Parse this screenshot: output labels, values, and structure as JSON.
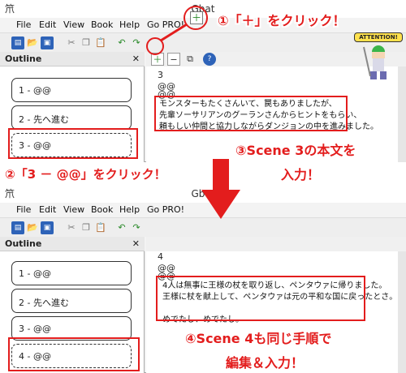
{
  "app": {
    "title": "Gbat",
    "icon_glyph": "笊"
  },
  "menu": [
    "File",
    "Edit",
    "View",
    "Book",
    "Help",
    "Go PRO!"
  ],
  "outline": {
    "header": "Outline",
    "close_glyph": "✕"
  },
  "top_window": {
    "scenes": [
      "1 - @@",
      "2 - 先へ進む",
      "3 - @@"
    ],
    "editor": {
      "scene_no": "3",
      "line1": "@@",
      "line2": "@@",
      "body": [
        "モンスターもたくさんいて、罠もありましたが、",
        "先輩ソーサリアンのグーランさんからヒントをもらい、",
        "頼もしい仲間と協力しながらダンジョンの中を進みました。"
      ]
    }
  },
  "bottom_window": {
    "scenes": [
      "1 - @@",
      "2 - 先へ進む",
      "3 - @@",
      "4 - @@"
    ],
    "editor": {
      "scene_no": "4",
      "line1": "@@",
      "line2": "@@",
      "body": [
        "4人は無事に王様の杖を取り返し、ペンタウァに帰りました。",
        "王様に杖を献上して、ペンタウァは元の平和な国に戻ったとさ。",
        "",
        "めでたし、めでたし。"
      ]
    }
  },
  "callouts": {
    "step1": "①「＋」をクリック！",
    "step2": "②「3 － @@」をクリック！",
    "step3a": "③Scene 3の本文を",
    "step3b": "入力！",
    "step4a": "④Scene 4も同じ手順で",
    "step4b": "編集＆入力！"
  },
  "mascot": {
    "badge": "ATTENTION!"
  },
  "colors": {
    "accent_red": "#e31d1d",
    "toolbar_blue": "#2e63b8",
    "add_green": "#2a8a2a"
  }
}
